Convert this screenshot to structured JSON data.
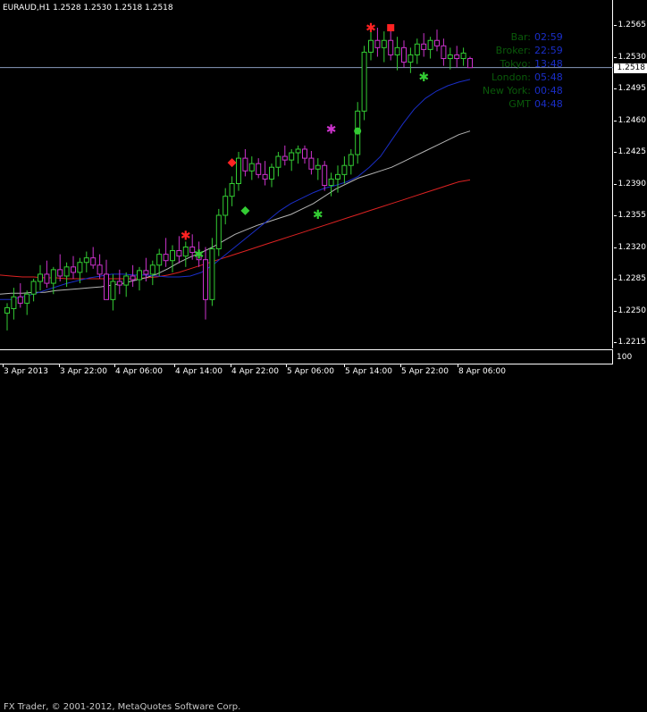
{
  "header": {
    "symbol_timeframe": "EURAUD,H1",
    "ohlc": "1.2528 1.2530 1.2518 1.2518"
  },
  "price_scale": {
    "ticks": [
      "1.2565",
      "1.2530",
      "1.2495",
      "1.2460",
      "1.2425",
      "1.2390",
      "1.2355",
      "1.2320",
      "1.2285",
      "1.2250",
      "1.2215"
    ],
    "current_price": "1.2518"
  },
  "indicator_scale": {
    "value": "100"
  },
  "time_axis": {
    "labels": [
      "3 Apr 2013",
      "3 Apr 22:00",
      "4 Apr 06:00",
      "4 Apr 14:00",
      "4 Apr 22:00",
      "5 Apr 06:00",
      "5 Apr 14:00",
      "5 Apr 22:00",
      "8 Apr 06:00"
    ]
  },
  "sessions": [
    {
      "name": "Bar:",
      "time": "02:59"
    },
    {
      "name": "Broker:",
      "time": "22:59"
    },
    {
      "name": "Tokyo:",
      "time": "13:48"
    },
    {
      "name": "London:",
      "time": "05:48"
    },
    {
      "name": "New York:",
      "time": "00:48"
    },
    {
      "name": "GMT",
      "time": "04:48"
    }
  ],
  "footer": {
    "copyright": "FX Trader, © 2001-2012, MetaQuotes Software Corp."
  },
  "colors": {
    "background": "#000000",
    "bull_candle": "#33cc33",
    "bear_candle": "#cc33cc",
    "ma_fast": "#1a2ec8",
    "ma_mid": "#b4b4b4",
    "ma_slow": "#dd2222",
    "session_name": "#0a5a0a",
    "session_time": "#1a2ec8"
  },
  "chart_data": {
    "type": "candlestick",
    "ylim": [
      1.2205,
      1.2575
    ],
    "bars": [
      [
        1.2247,
        1.2258,
        1.2228,
        1.2253
      ],
      [
        1.2252,
        1.2275,
        1.224,
        1.2265
      ],
      [
        1.2265,
        1.228,
        1.2253,
        1.2258
      ],
      [
        1.2258,
        1.2272,
        1.2245,
        1.2268
      ],
      [
        1.2268,
        1.2285,
        1.226,
        1.2282
      ],
      [
        1.2282,
        1.23,
        1.2272,
        1.229
      ],
      [
        1.229,
        1.2305,
        1.2275,
        1.228
      ],
      [
        1.228,
        1.2298,
        1.2268,
        1.2295
      ],
      [
        1.2295,
        1.2312,
        1.2282,
        1.2288
      ],
      [
        1.2288,
        1.2303,
        1.2276,
        1.2298
      ],
      [
        1.2298,
        1.231,
        1.2285,
        1.2292
      ],
      [
        1.2292,
        1.2308,
        1.228,
        1.2303
      ],
      [
        1.2303,
        1.2315,
        1.2292,
        1.2308
      ],
      [
        1.2308,
        1.232,
        1.2296,
        1.23
      ],
      [
        1.23,
        1.2312,
        1.2285,
        1.229
      ],
      [
        1.229,
        1.2306,
        1.2275,
        1.2262
      ],
      [
        1.2262,
        1.229,
        1.225,
        1.2282
      ],
      [
        1.2282,
        1.2295,
        1.2268,
        1.2278
      ],
      [
        1.2278,
        1.2292,
        1.2265,
        1.2288
      ],
      [
        1.2288,
        1.23,
        1.2276,
        1.2284
      ],
      [
        1.2284,
        1.2298,
        1.2272,
        1.2294
      ],
      [
        1.2294,
        1.2308,
        1.2282,
        1.229
      ],
      [
        1.229,
        1.2305,
        1.2278,
        1.23
      ],
      [
        1.23,
        1.2318,
        1.2288,
        1.2312
      ],
      [
        1.2312,
        1.233,
        1.2298,
        1.2305
      ],
      [
        1.2305,
        1.2322,
        1.2292,
        1.2316
      ],
      [
        1.2316,
        1.2332,
        1.2302,
        1.231
      ],
      [
        1.231,
        1.2326,
        1.2298,
        1.232
      ],
      [
        1.232,
        1.2334,
        1.2306,
        1.2314
      ],
      [
        1.2314,
        1.2326,
        1.2298,
        1.2306
      ],
      [
        1.2306,
        1.232,
        1.224,
        1.2262
      ],
      [
        1.2262,
        1.233,
        1.2255,
        1.2318
      ],
      [
        1.2318,
        1.2362,
        1.231,
        1.2355
      ],
      [
        1.2355,
        1.2385,
        1.2345,
        1.2376
      ],
      [
        1.2376,
        1.2398,
        1.2365,
        1.239
      ],
      [
        1.239,
        1.2425,
        1.2382,
        1.2418
      ],
      [
        1.2418,
        1.2428,
        1.2398,
        1.2404
      ],
      [
        1.2404,
        1.242,
        1.2394,
        1.2412
      ],
      [
        1.2412,
        1.2418,
        1.2396,
        1.24
      ],
      [
        1.24,
        1.2415,
        1.2388,
        1.2395
      ],
      [
        1.2395,
        1.2412,
        1.2386,
        1.2408
      ],
      [
        1.2408,
        1.2425,
        1.2398,
        1.242
      ],
      [
        1.242,
        1.2432,
        1.241,
        1.2416
      ],
      [
        1.2416,
        1.2428,
        1.2404,
        1.2424
      ],
      [
        1.2424,
        1.2432,
        1.2412,
        1.2428
      ],
      [
        1.2428,
        1.2432,
        1.2412,
        1.2418
      ],
      [
        1.2418,
        1.2426,
        1.24,
        1.2406
      ],
      [
        1.2406,
        1.2418,
        1.2394,
        1.241
      ],
      [
        1.241,
        1.2415,
        1.2382,
        1.2388
      ],
      [
        1.2388,
        1.2402,
        1.2376,
        1.2395
      ],
      [
        1.2395,
        1.241,
        1.238,
        1.24
      ],
      [
        1.24,
        1.242,
        1.239,
        1.241
      ],
      [
        1.241,
        1.2428,
        1.24,
        1.2422
      ],
      [
        1.2422,
        1.248,
        1.2412,
        1.247
      ],
      [
        1.247,
        1.2542,
        1.246,
        1.2535
      ],
      [
        1.2535,
        1.2566,
        1.2526,
        1.2548
      ],
      [
        1.2548,
        1.2562,
        1.253,
        1.254
      ],
      [
        1.254,
        1.2558,
        1.2524,
        1.2548
      ],
      [
        1.2548,
        1.256,
        1.2526,
        1.2532
      ],
      [
        1.2532,
        1.2552,
        1.2515,
        1.254
      ],
      [
        1.254,
        1.2548,
        1.2518,
        1.2524
      ],
      [
        1.2524,
        1.254,
        1.2512,
        1.2532
      ],
      [
        1.2532,
        1.255,
        1.2522,
        1.2544
      ],
      [
        1.2544,
        1.2556,
        1.253,
        1.2538
      ],
      [
        1.2538,
        1.2552,
        1.2528,
        1.2548
      ],
      [
        1.2548,
        1.256,
        1.2536,
        1.2542
      ],
      [
        1.2542,
        1.255,
        1.252,
        1.2528
      ],
      [
        1.2528,
        1.254,
        1.2516,
        1.2532
      ],
      [
        1.2532,
        1.2542,
        1.2518,
        1.2528
      ],
      [
        1.2528,
        1.254,
        1.252,
        1.2534
      ],
      [
        1.2528,
        1.253,
        1.2518,
        1.2518
      ]
    ],
    "ma_fast": [
      1.2262,
      1.2262,
      1.2265,
      1.2268,
      1.2272,
      1.2276,
      1.228,
      1.2283,
      1.2286,
      1.2288,
      1.229,
      1.229,
      1.2289,
      1.2289,
      1.2288,
      1.2287,
      1.2287,
      1.2288,
      1.2292,
      1.23,
      1.231,
      1.232,
      1.233,
      1.234,
      1.235,
      1.236,
      1.2368,
      1.2374,
      1.238,
      1.2385,
      1.2388,
      1.2392,
      1.2398,
      1.2408,
      1.242,
      1.2438,
      1.2456,
      1.2472,
      1.2484,
      1.2492,
      1.2498,
      1.2502,
      1.2505
    ],
    "ma_mid": [
      1.2268,
      1.2269,
      1.2269,
      1.227,
      1.227,
      1.2272,
      1.2273,
      1.2274,
      1.2275,
      1.2276,
      1.2278,
      1.228,
      1.2283,
      1.2286,
      1.229,
      1.2296,
      1.2303,
      1.2309,
      1.2314,
      1.232,
      1.2327,
      1.2334,
      1.2339,
      1.2344,
      1.2348,
      1.2352,
      1.2356,
      1.2362,
      1.2368,
      1.2376,
      1.2384,
      1.239,
      1.2396,
      1.24,
      1.2404,
      1.2408,
      1.2414,
      1.242,
      1.2426,
      1.2432,
      1.2438,
      1.2444,
      1.2448
    ],
    "ma_slow": [
      1.2289,
      1.2288,
      1.2287,
      1.2287,
      1.2286,
      1.2286,
      1.2285,
      1.2285,
      1.2285,
      1.2285,
      1.2285,
      1.2285,
      1.2285,
      1.2286,
      1.2287,
      1.2289,
      1.2292,
      1.2296,
      1.23,
      1.2304,
      1.2308,
      1.2312,
      1.2316,
      1.232,
      1.2324,
      1.2328,
      1.2332,
      1.2336,
      1.234,
      1.2344,
      1.2348,
      1.2352,
      1.2356,
      1.236,
      1.2364,
      1.2368,
      1.2372,
      1.2376,
      1.238,
      1.2384,
      1.2388,
      1.2392,
      1.2394
    ],
    "markers": [
      {
        "shape": "star",
        "color": "#ff2222",
        "price": 1.2562,
        "bar": 55
      },
      {
        "shape": "square",
        "color": "#ff2222",
        "price": 1.2562,
        "bar": 58
      },
      {
        "shape": "star",
        "color": "#33cc33",
        "price": 1.2508,
        "bar": 63
      },
      {
        "shape": "star",
        "color": "#cc33cc",
        "price": 1.245,
        "bar": 49
      },
      {
        "shape": "circle",
        "color": "#33cc33",
        "price": 1.2448,
        "bar": 53
      },
      {
        "shape": "diamond",
        "color": "#ff2222",
        "price": 1.2413,
        "bar": 34
      },
      {
        "shape": "diamond",
        "color": "#33cc33",
        "price": 1.236,
        "bar": 36
      },
      {
        "shape": "star",
        "color": "#33cc33",
        "price": 1.2356,
        "bar": 47
      },
      {
        "shape": "star",
        "color": "#ff2222",
        "price": 1.2333,
        "bar": 27
      },
      {
        "shape": "star",
        "color": "#33cc33",
        "price": 1.2312,
        "bar": 29
      }
    ]
  }
}
